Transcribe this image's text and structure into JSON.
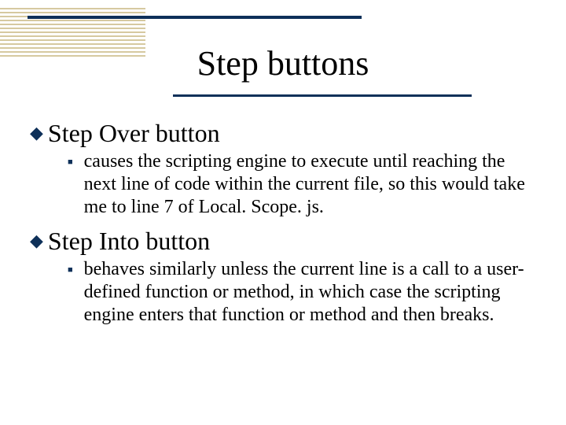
{
  "title": "Step buttons",
  "items": [
    {
      "heading": "Step Over button",
      "detail": "causes the scripting engine to execute until reaching the next line of code within the current file, so this would take me to line 7 of Local. Scope. js."
    },
    {
      "heading": "Step Into button",
      "detail": "behaves similarly unless the current line is a call to a user-defined function or method, in which case the scripting engine enters that function or method and then breaks."
    }
  ]
}
